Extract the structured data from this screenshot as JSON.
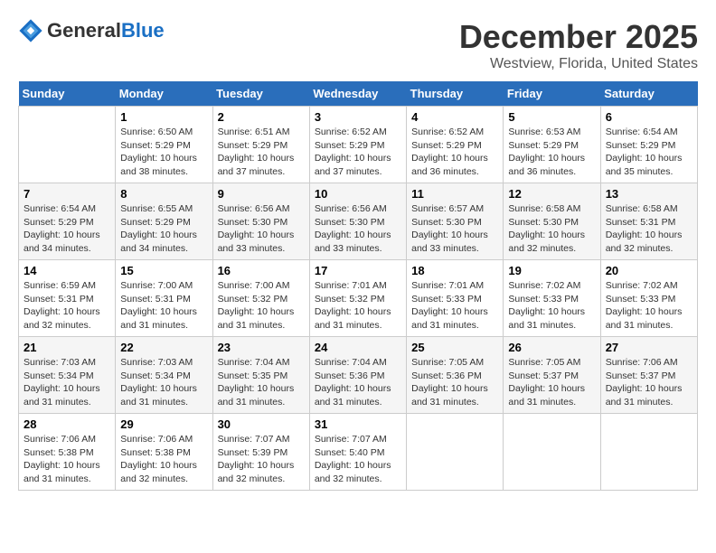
{
  "header": {
    "logo_line1": "General",
    "logo_line2": "Blue",
    "month": "December 2025",
    "location": "Westview, Florida, United States"
  },
  "days_of_week": [
    "Sunday",
    "Monday",
    "Tuesday",
    "Wednesday",
    "Thursday",
    "Friday",
    "Saturday"
  ],
  "weeks": [
    [
      {
        "day": "",
        "info": ""
      },
      {
        "day": "1",
        "info": "Sunrise: 6:50 AM\nSunset: 5:29 PM\nDaylight: 10 hours\nand 38 minutes."
      },
      {
        "day": "2",
        "info": "Sunrise: 6:51 AM\nSunset: 5:29 PM\nDaylight: 10 hours\nand 37 minutes."
      },
      {
        "day": "3",
        "info": "Sunrise: 6:52 AM\nSunset: 5:29 PM\nDaylight: 10 hours\nand 37 minutes."
      },
      {
        "day": "4",
        "info": "Sunrise: 6:52 AM\nSunset: 5:29 PM\nDaylight: 10 hours\nand 36 minutes."
      },
      {
        "day": "5",
        "info": "Sunrise: 6:53 AM\nSunset: 5:29 PM\nDaylight: 10 hours\nand 36 minutes."
      },
      {
        "day": "6",
        "info": "Sunrise: 6:54 AM\nSunset: 5:29 PM\nDaylight: 10 hours\nand 35 minutes."
      }
    ],
    [
      {
        "day": "7",
        "info": "Sunrise: 6:54 AM\nSunset: 5:29 PM\nDaylight: 10 hours\nand 34 minutes."
      },
      {
        "day": "8",
        "info": "Sunrise: 6:55 AM\nSunset: 5:29 PM\nDaylight: 10 hours\nand 34 minutes."
      },
      {
        "day": "9",
        "info": "Sunrise: 6:56 AM\nSunset: 5:30 PM\nDaylight: 10 hours\nand 33 minutes."
      },
      {
        "day": "10",
        "info": "Sunrise: 6:56 AM\nSunset: 5:30 PM\nDaylight: 10 hours\nand 33 minutes."
      },
      {
        "day": "11",
        "info": "Sunrise: 6:57 AM\nSunset: 5:30 PM\nDaylight: 10 hours\nand 33 minutes."
      },
      {
        "day": "12",
        "info": "Sunrise: 6:58 AM\nSunset: 5:30 PM\nDaylight: 10 hours\nand 32 minutes."
      },
      {
        "day": "13",
        "info": "Sunrise: 6:58 AM\nSunset: 5:31 PM\nDaylight: 10 hours\nand 32 minutes."
      }
    ],
    [
      {
        "day": "14",
        "info": "Sunrise: 6:59 AM\nSunset: 5:31 PM\nDaylight: 10 hours\nand 32 minutes."
      },
      {
        "day": "15",
        "info": "Sunrise: 7:00 AM\nSunset: 5:31 PM\nDaylight: 10 hours\nand 31 minutes."
      },
      {
        "day": "16",
        "info": "Sunrise: 7:00 AM\nSunset: 5:32 PM\nDaylight: 10 hours\nand 31 minutes."
      },
      {
        "day": "17",
        "info": "Sunrise: 7:01 AM\nSunset: 5:32 PM\nDaylight: 10 hours\nand 31 minutes."
      },
      {
        "day": "18",
        "info": "Sunrise: 7:01 AM\nSunset: 5:33 PM\nDaylight: 10 hours\nand 31 minutes."
      },
      {
        "day": "19",
        "info": "Sunrise: 7:02 AM\nSunset: 5:33 PM\nDaylight: 10 hours\nand 31 minutes."
      },
      {
        "day": "20",
        "info": "Sunrise: 7:02 AM\nSunset: 5:33 PM\nDaylight: 10 hours\nand 31 minutes."
      }
    ],
    [
      {
        "day": "21",
        "info": "Sunrise: 7:03 AM\nSunset: 5:34 PM\nDaylight: 10 hours\nand 31 minutes."
      },
      {
        "day": "22",
        "info": "Sunrise: 7:03 AM\nSunset: 5:34 PM\nDaylight: 10 hours\nand 31 minutes."
      },
      {
        "day": "23",
        "info": "Sunrise: 7:04 AM\nSunset: 5:35 PM\nDaylight: 10 hours\nand 31 minutes."
      },
      {
        "day": "24",
        "info": "Sunrise: 7:04 AM\nSunset: 5:36 PM\nDaylight: 10 hours\nand 31 minutes."
      },
      {
        "day": "25",
        "info": "Sunrise: 7:05 AM\nSunset: 5:36 PM\nDaylight: 10 hours\nand 31 minutes."
      },
      {
        "day": "26",
        "info": "Sunrise: 7:05 AM\nSunset: 5:37 PM\nDaylight: 10 hours\nand 31 minutes."
      },
      {
        "day": "27",
        "info": "Sunrise: 7:06 AM\nSunset: 5:37 PM\nDaylight: 10 hours\nand 31 minutes."
      }
    ],
    [
      {
        "day": "28",
        "info": "Sunrise: 7:06 AM\nSunset: 5:38 PM\nDaylight: 10 hours\nand 31 minutes."
      },
      {
        "day": "29",
        "info": "Sunrise: 7:06 AM\nSunset: 5:38 PM\nDaylight: 10 hours\nand 32 minutes."
      },
      {
        "day": "30",
        "info": "Sunrise: 7:07 AM\nSunset: 5:39 PM\nDaylight: 10 hours\nand 32 minutes."
      },
      {
        "day": "31",
        "info": "Sunrise: 7:07 AM\nSunset: 5:40 PM\nDaylight: 10 hours\nand 32 minutes."
      },
      {
        "day": "",
        "info": ""
      },
      {
        "day": "",
        "info": ""
      },
      {
        "day": "",
        "info": ""
      }
    ]
  ]
}
